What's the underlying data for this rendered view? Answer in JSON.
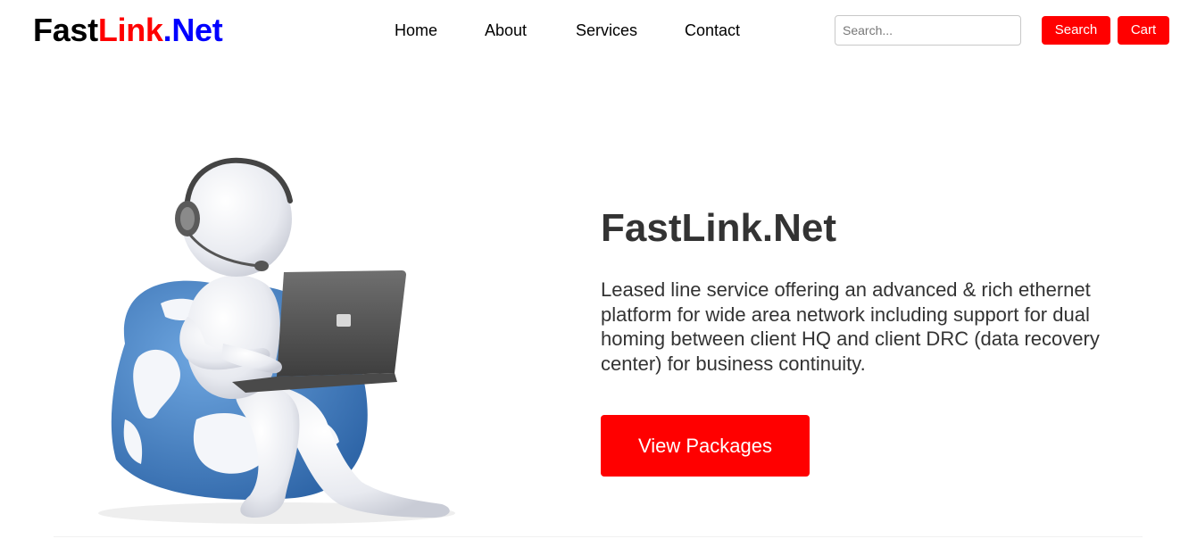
{
  "brand": {
    "part1": "Fast",
    "part2": "Link",
    "part3": ".Net"
  },
  "colors": {
    "accent": "#ff0000",
    "brand_fast": "#000000",
    "brand_link": "#ff0000",
    "brand_net": "#0000ff",
    "heading_text": "#333333",
    "globe_blue": "#4a86c8"
  },
  "nav": {
    "items": [
      "Home",
      "About",
      "Services",
      "Contact"
    ]
  },
  "search": {
    "placeholder": "Search...",
    "value": ""
  },
  "header_buttons": {
    "search_label": "Search",
    "cart_label": "Cart"
  },
  "hero": {
    "title": "FastLink.Net",
    "description": "Leased line service offering an advanced & rich ethernet platform for wide area network including support for dual homing between client HQ and client DRC (data recovery center) for business continuity.",
    "cta_label": "View Packages",
    "illustration_icon": "support-agent-laptop-globe-beanbag"
  }
}
